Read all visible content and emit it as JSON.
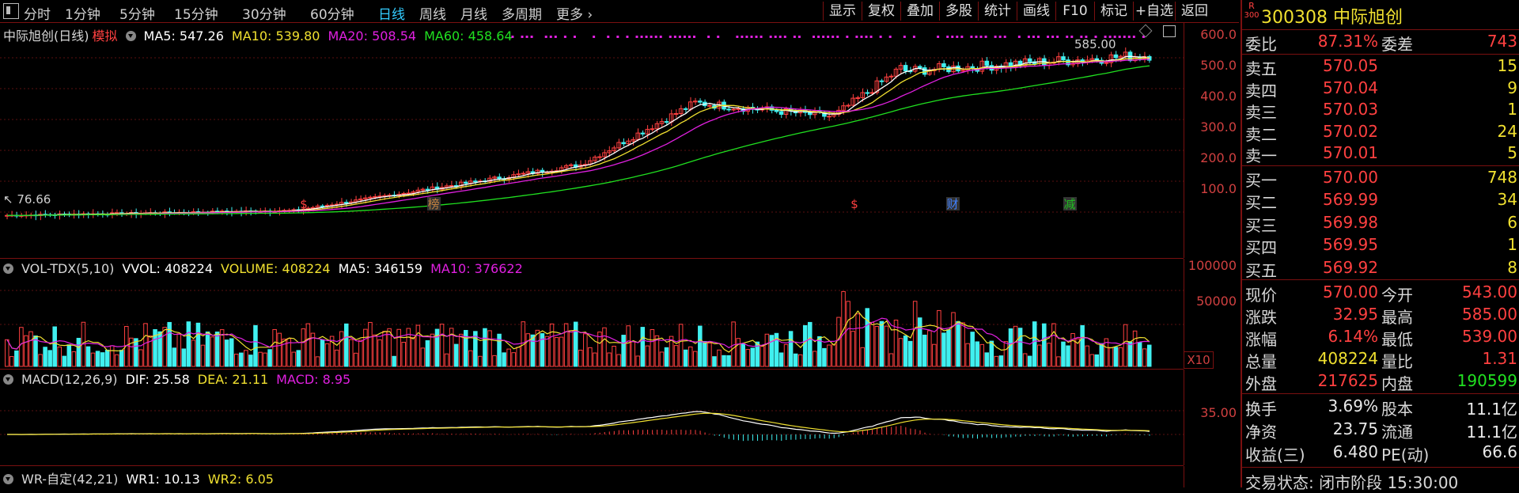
{
  "toolbar": {
    "periods": [
      "分时",
      "1分钟",
      "5分钟",
      "15分钟",
      "30分钟",
      "60分钟",
      "日线",
      "周线",
      "月线",
      "多周期",
      "更多"
    ],
    "active_period": "日线",
    "right_buttons": [
      "显示",
      "复权",
      "叠加",
      "多股",
      "统计",
      "画线",
      "F10",
      "标记",
      "+自选",
      "返回"
    ]
  },
  "main_chart": {
    "title": "中际旭创(日线)",
    "mode": "模拟",
    "ma5": "MA5: 547.26",
    "ma10": "MA10: 539.80",
    "ma20": "MA20: 508.54",
    "ma60": "MA60: 458.64",
    "high_label": "585.00",
    "low_label": "76.66",
    "markers": [
      "$",
      "榜",
      "$",
      "财",
      "减"
    ],
    "colors": {
      "ma5": "#ffffff",
      "ma10": "#f0e030",
      "ma20": "#e020e0",
      "ma60": "#20e020",
      "up": "#ff4040",
      "down": "#40f0f0"
    }
  },
  "vol_chart": {
    "title": "VOL-TDX(5,10)",
    "vvol": "VVOL: 408224",
    "volume": "VOLUME: 408224",
    "ma5": "MA5: 346159",
    "ma10": "MA10: 376622",
    "x_label": "X10"
  },
  "macd_chart": {
    "title": "MACD(12,26,9)",
    "dif": "DIF: 25.58",
    "dea": "DEA: 21.11",
    "macd": "MACD: 8.95"
  },
  "wr_chart": {
    "title": "WR-自定(42,21)",
    "wr1": "WR1: 10.13",
    "wr2": "WR2: 6.05"
  },
  "axes": {
    "main_ticks": [
      "600.0",
      "500.0",
      "400.0",
      "300.0",
      "200.0",
      "100.0"
    ],
    "vol_ticks": [
      "100000",
      "50000"
    ],
    "macd_ticks": [
      "35.00"
    ]
  },
  "stock": {
    "badge": "R\n300",
    "code": "300308",
    "name": "中际旭创"
  },
  "order_book": {
    "weibi_label": "委比",
    "weibi": "87.31%",
    "weicha_label": "委差",
    "weicha": "743",
    "asks": [
      {
        "label": "卖五",
        "price": "570.05",
        "vol": "15"
      },
      {
        "label": "卖四",
        "price": "570.04",
        "vol": "9"
      },
      {
        "label": "卖三",
        "price": "570.03",
        "vol": "1"
      },
      {
        "label": "卖二",
        "price": "570.02",
        "vol": "24"
      },
      {
        "label": "卖一",
        "price": "570.01",
        "vol": "5"
      }
    ],
    "bids": [
      {
        "label": "买一",
        "price": "570.00",
        "vol": "748"
      },
      {
        "label": "买二",
        "price": "569.99",
        "vol": "34"
      },
      {
        "label": "买三",
        "price": "569.98",
        "vol": "6"
      },
      {
        "label": "买四",
        "price": "569.95",
        "vol": "1"
      },
      {
        "label": "买五",
        "price": "569.92",
        "vol": "8"
      }
    ]
  },
  "quote": {
    "rows": [
      {
        "l1": "现价",
        "v1": "570.00",
        "c1": "red",
        "l2": "今开",
        "v2": "543.00",
        "c2": "red"
      },
      {
        "l1": "涨跌",
        "v1": "32.95",
        "c1": "red",
        "l2": "最高",
        "v2": "585.00",
        "c2": "red"
      },
      {
        "l1": "涨幅",
        "v1": "6.14%",
        "c1": "red",
        "l2": "最低",
        "v2": "539.00",
        "c2": "red"
      },
      {
        "l1": "总量",
        "v1": "408224",
        "c1": "yellow",
        "l2": "量比",
        "v2": "1.31",
        "c2": "red"
      },
      {
        "l1": "外盘",
        "v1": "217625",
        "c1": "red",
        "l2": "内盘",
        "v2": "190599",
        "c2": "green"
      }
    ],
    "rows2": [
      {
        "l1": "换手",
        "v1": "3.69%",
        "c1": "white",
        "l2": "股本",
        "v2": "11.1亿",
        "c2": "white"
      },
      {
        "l1": "净资",
        "v1": "23.75",
        "c1": "white",
        "l2": "流通",
        "v2": "11.1亿",
        "c2": "white"
      },
      {
        "l1": "收益(三)",
        "v1": "6.480",
        "c1": "white",
        "l2": "PE(动)",
        "v2": "66.6",
        "c2": "white"
      }
    ],
    "status": "交易状态: 闭市阶段 15:30:00"
  }
}
